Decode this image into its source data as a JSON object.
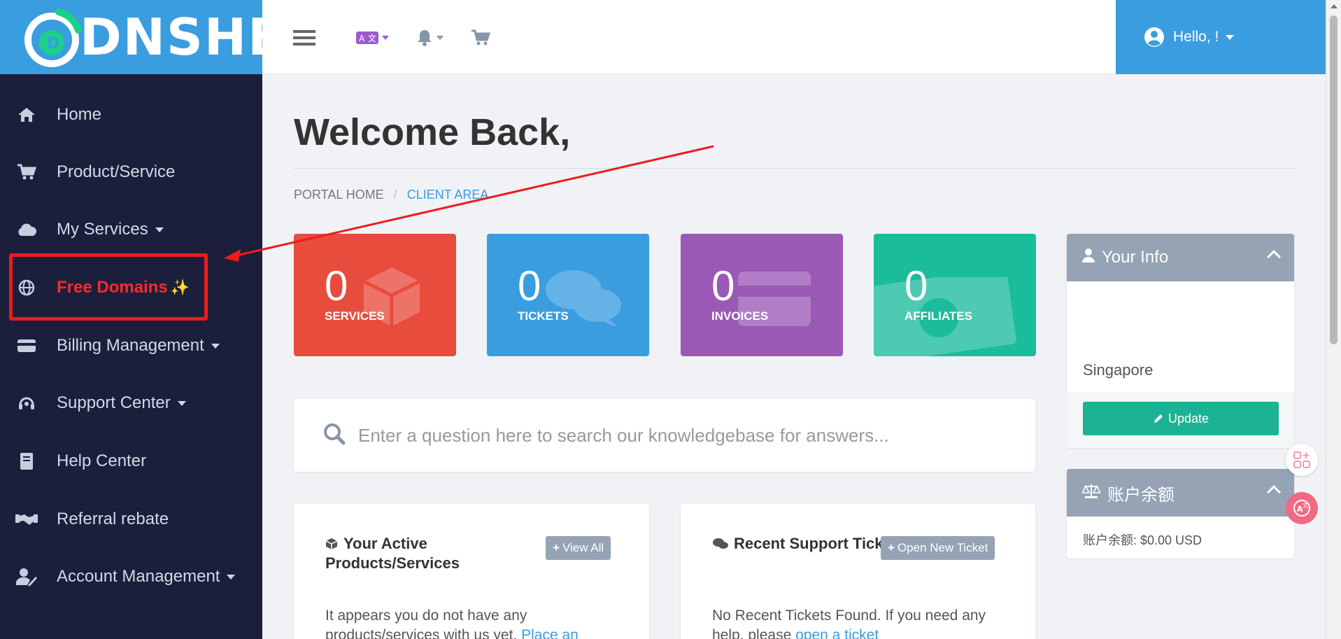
{
  "brand": {
    "name": "DNSHE",
    "accent": "#3a9de0",
    "sidebar_bg": "#1b1f3b"
  },
  "sidebar": {
    "items": [
      {
        "label": "Home",
        "icon": "home-icon",
        "has_caret": false
      },
      {
        "label": "Product/Service",
        "icon": "cart-icon",
        "has_caret": false
      },
      {
        "label": "My Services",
        "icon": "cloud-icon",
        "has_caret": true
      },
      {
        "label": "Free Domains",
        "icon": "globe-icon",
        "has_caret": false,
        "highlighted": true,
        "emoji": "✨"
      },
      {
        "label": "Billing Management",
        "icon": "credit-card-icon",
        "has_caret": true
      },
      {
        "label": "Support Center",
        "icon": "headset-icon",
        "has_caret": true
      },
      {
        "label": "Help Center",
        "icon": "book-icon",
        "has_caret": false
      },
      {
        "label": "Referral rebate",
        "icon": "handshake-icon",
        "has_caret": false
      },
      {
        "label": "Account Management",
        "icon": "user-edit-icon",
        "has_caret": true
      }
    ]
  },
  "header": {
    "icons": [
      "menu-icon",
      "language-icon",
      "bell-icon",
      "cart-icon"
    ],
    "user_greeting": "Hello, !"
  },
  "main": {
    "title": "Welcome Back,",
    "breadcrumb": [
      {
        "label": "PORTAL HOME",
        "active": false
      },
      {
        "label": "CLIENT AREA",
        "active": true
      }
    ],
    "tiles": [
      {
        "count": "0",
        "label": "SERVICES",
        "color": "#e84c3d",
        "icon": "box-icon"
      },
      {
        "count": "0",
        "label": "TICKETS",
        "color": "#3a9de0",
        "icon": "comments-icon"
      },
      {
        "count": "0",
        "label": "INVOICES",
        "color": "#9b59b6",
        "icon": "credit-card-icon"
      },
      {
        "count": "0",
        "label": "AFFILIATES",
        "color": "#1bbc9b",
        "icon": "money-icon"
      }
    ],
    "kb_search": {
      "placeholder": "Enter a question here to search our knowledgebase for answers..."
    },
    "cards": [
      {
        "title": "Your Active Products/Services",
        "button": "View All",
        "text": "It appears you do not have any products/services with us yet.",
        "link": "Place an"
      },
      {
        "title": "Recent Support Tickets",
        "button": "Open New Ticket",
        "text": "No Recent Tickets Found. If you need any help, please",
        "link": "open a ticket"
      }
    ]
  },
  "right": {
    "info": {
      "title": "Your Info",
      "location": "Singapore",
      "update_label": "Update"
    },
    "balance": {
      "title": "账户余额",
      "value": "账户余额: $0.00 USD"
    }
  }
}
